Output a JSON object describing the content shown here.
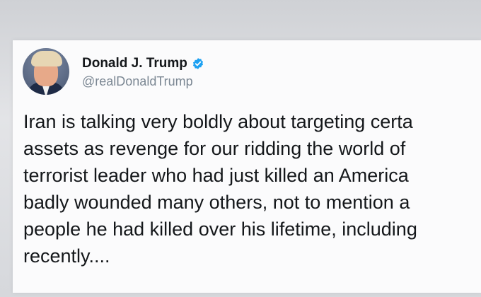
{
  "tweet": {
    "display_name": "Donald J. Trump",
    "handle": "@realDonaldTrump",
    "verified_icon": "verified-badge-icon",
    "avatar_icon": "profile-avatar",
    "lines": [
      "Iran is talking very boldly about targeting certa",
      "assets as revenge for our ridding the world of",
      "terrorist leader who had just killed an America",
      "badly wounded many others, not to mention a",
      "people he had killed over his lifetime, including",
      "recently...."
    ]
  },
  "colors": {
    "card_background": "#fbfbfc",
    "text": "#14171a",
    "handle": "#7b8793",
    "verified": "#1da1f2"
  }
}
